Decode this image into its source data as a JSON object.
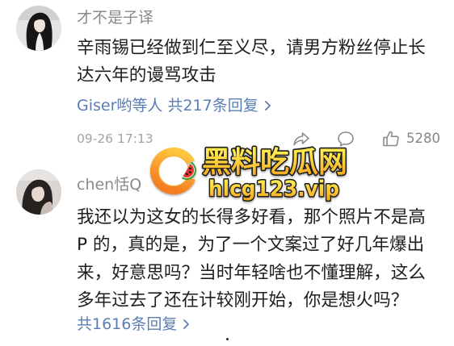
{
  "colors": {
    "text": "#1e1e1e",
    "username": "#8a8a8a",
    "link": "#5a7db5",
    "timestamp": "#a3a3a3",
    "like-count": "#858585",
    "icon": "#8c8c8c",
    "logo-ring-light": "#ffc53d",
    "logo-ring-dark": "#f47b20",
    "watermark-top": "#ffe94d",
    "watermark-bottom": "#f5a01e",
    "watermark-outline": "#1c1c1c"
  },
  "comments": [
    {
      "username": "才不是子译",
      "lines": [
        "辛雨锡已经做到仁至义尽，请男方粉丝停止长",
        "达六年的谩骂攻击"
      ],
      "replies": "Giser哟等人 共217条回复",
      "timestamp": "09-26 17:13",
      "likes": "5280",
      "icons": {
        "avatar": "avatar-photo",
        "replies": "chevron-right-icon",
        "share": "share-icon",
        "comment": "comment-icon",
        "like": "thumbs-up-icon"
      }
    },
    {
      "username": "chen恬Q",
      "lines": [
        "我还以为这女的长得多好看，那个照片不是高",
        "P 的，真的是，为了一个文案过了好几年爆出",
        "来，好意思吗？当时年轻啥也不懂理解，这么",
        "多年过去了还在计较刚开始，你是想火吗？"
      ],
      "replies": "共1616条回复",
      "icons": {
        "avatar": "avatar-photo",
        "replies": "chevron-right-icon"
      }
    }
  ],
  "watermark": {
    "site_name": "黑料吃瓜网",
    "domain": "hlcg123.vip",
    "logo_icon": "watermelon-logo-icon"
  }
}
